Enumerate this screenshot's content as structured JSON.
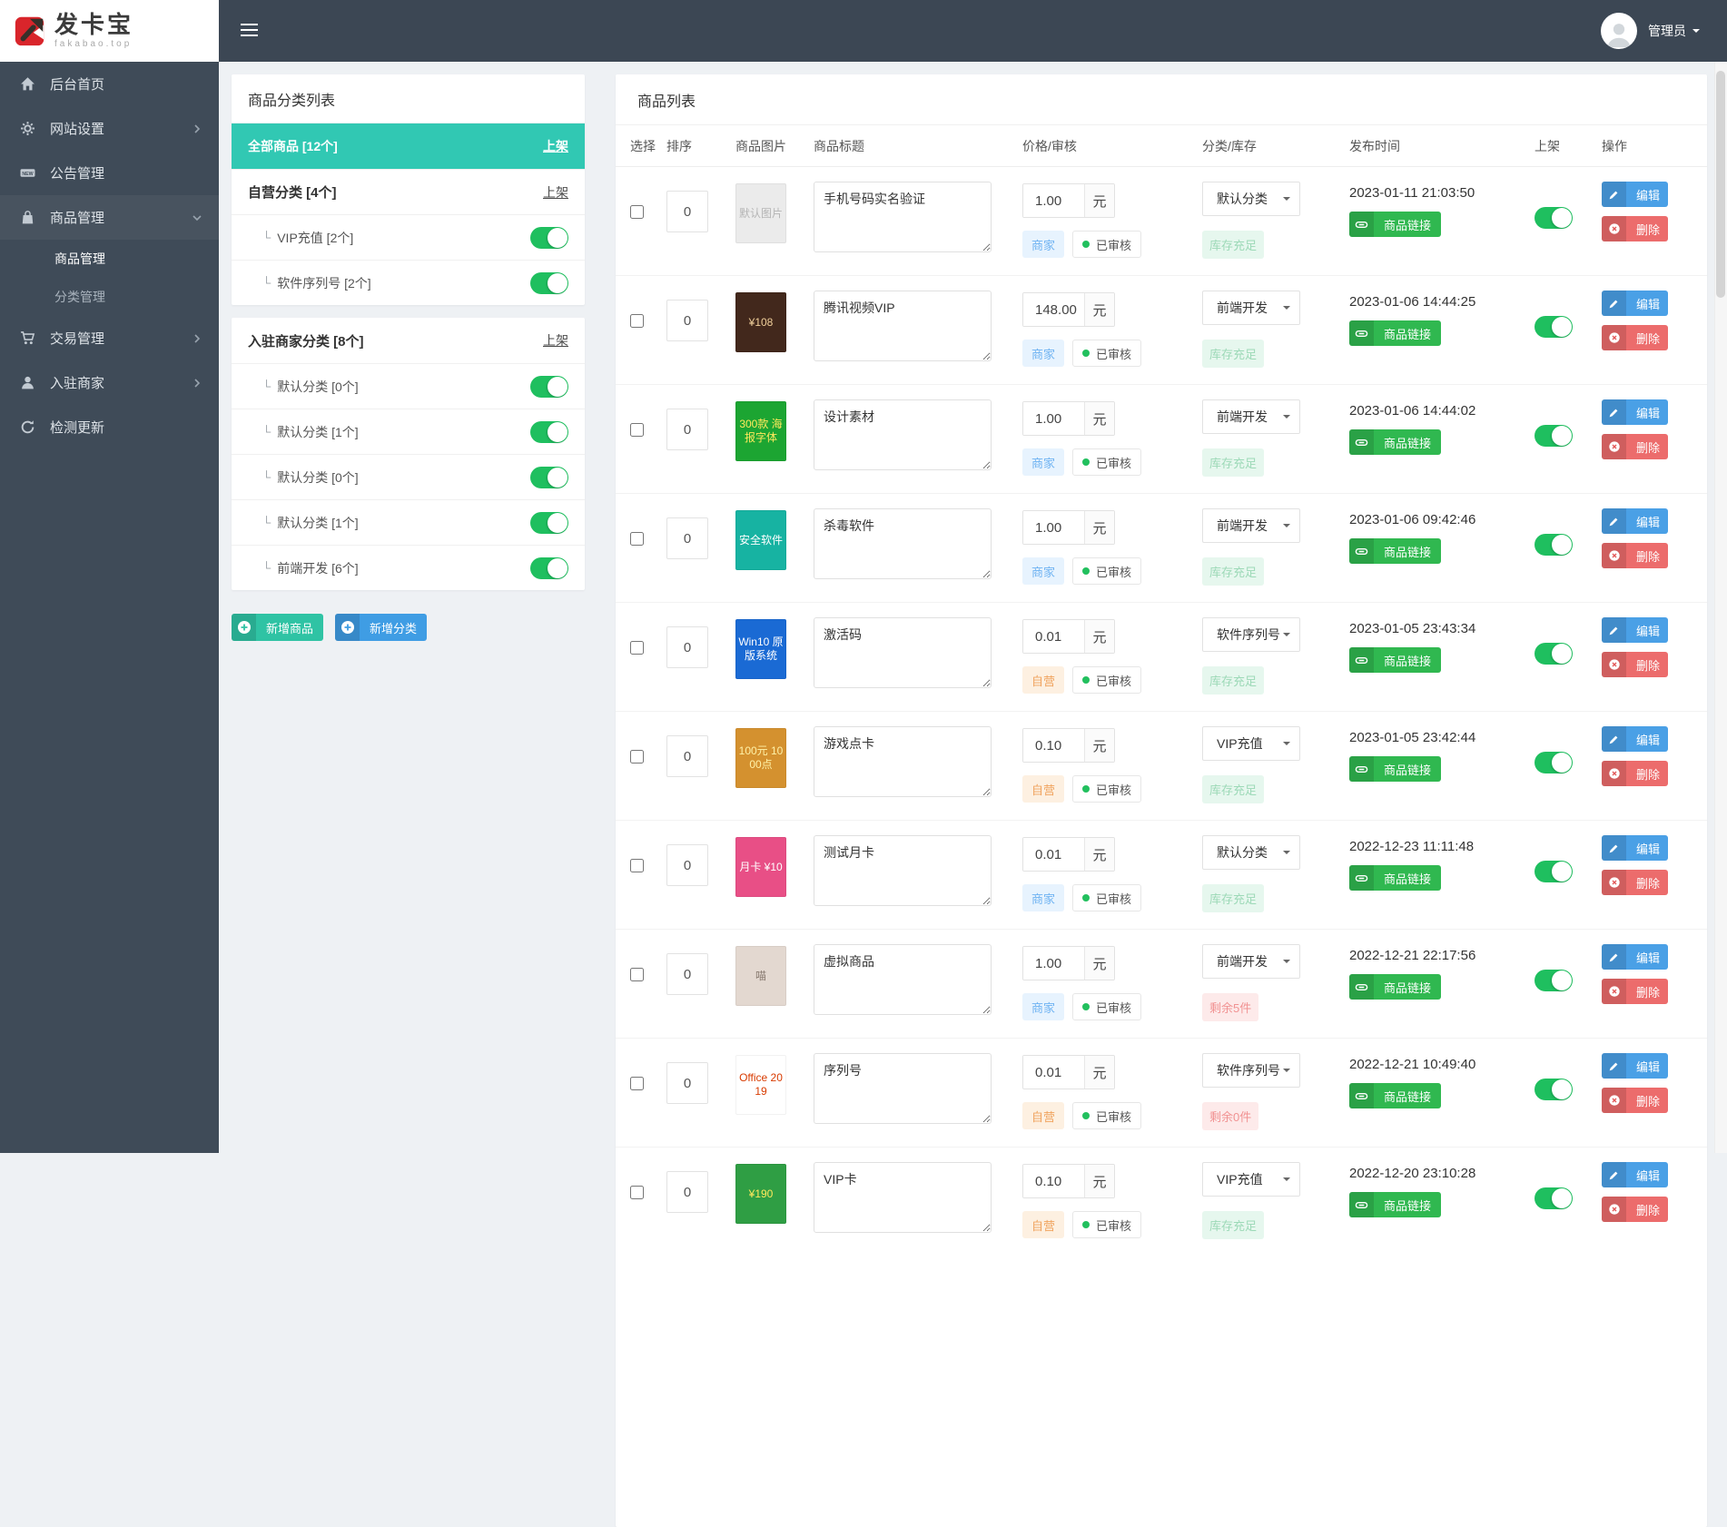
{
  "colors": {
    "accent_teal": "#31c8b3",
    "toggle_green": "#1fbf5f",
    "edit_blue": "#4aa0e6",
    "delete_red": "#ec6c6c",
    "link_green": "#30b850",
    "add_product_teal": "#2fc3a4",
    "add_category_blue": "#3f9de4",
    "sidebar_dark": "#3f4b58"
  },
  "topbar": {
    "logo_title": "发卡宝",
    "logo_subtitle": "fakabao.top",
    "user_label": "管理员"
  },
  "sidebar": {
    "items": [
      {
        "label": "后台首页"
      },
      {
        "label": "网站设置"
      },
      {
        "label": "公告管理"
      },
      {
        "label": "商品管理"
      },
      {
        "label": "交易管理"
      },
      {
        "label": "入驻商家"
      },
      {
        "label": "检测更新"
      }
    ],
    "submenu": [
      {
        "label": "商品管理"
      },
      {
        "label": "分类管理"
      }
    ]
  },
  "category_panel": {
    "title": "商品分类列表",
    "sub_prefix": "└",
    "selected": {
      "label": "全部商品 [12个]",
      "action": "上架"
    },
    "group1": {
      "header": "自营分类 [4个]",
      "action": "上架",
      "subs": [
        {
          "label": "VIP充值 [2个]"
        },
        {
          "label": "软件序列号 [2个]"
        }
      ]
    },
    "group2": {
      "header": "入驻商家分类 [8个]",
      "action": "上架",
      "subs": [
        {
          "label": "默认分类 [0个]"
        },
        {
          "label": "默认分类 [1个]"
        },
        {
          "label": "默认分类 [0个]"
        },
        {
          "label": "默认分类 [1个]"
        },
        {
          "label": "前端开发 [6个]"
        }
      ]
    },
    "add_product_label": "新增商品",
    "add_category_label": "新增分类"
  },
  "product_panel": {
    "title": "商品列表",
    "columns": [
      "选择",
      "排序",
      "商品图片",
      "商品标题",
      "价格/审核",
      "分类/库存",
      "发布时间",
      "上架",
      "操作"
    ],
    "price_unit": "元",
    "audit_label": "已审核",
    "link_label": "商品链接",
    "edit_label": "编辑",
    "delete_label": "删除",
    "rows": [
      {
        "sort": "0",
        "image": {
          "text": "默认图片",
          "bg": "#ebebeb",
          "fg": "#b5b5b5"
        },
        "title": "手机号码实名验证",
        "price": "1.00",
        "seller": "商家",
        "seller_type": "blue",
        "category": "默认分类",
        "stock": "库存充足",
        "stock_type": "ok",
        "date": "2023-01-11 21:03:50"
      },
      {
        "sort": "0",
        "image": {
          "text": "¥108",
          "bg": "#42281c",
          "fg": "#f0cf9a"
        },
        "title": "腾讯视频VIP",
        "price": "148.00",
        "seller": "商家",
        "seller_type": "blue",
        "category": "前端开发",
        "stock": "库存充足",
        "stock_type": "ok",
        "date": "2023-01-06 14:44:25"
      },
      {
        "sort": "0",
        "image": {
          "text": "300款 海报字体",
          "bg": "#1ca532",
          "fg": "#ffe95c"
        },
        "title": "设计素材",
        "price": "1.00",
        "seller": "商家",
        "seller_type": "blue",
        "category": "前端开发",
        "stock": "库存充足",
        "stock_type": "ok",
        "date": "2023-01-06 14:44:02"
      },
      {
        "sort": "0",
        "image": {
          "text": "安全软件",
          "bg": "#17b3a2",
          "fg": "#ffffff"
        },
        "title": "杀毒软件",
        "price": "1.00",
        "seller": "商家",
        "seller_type": "blue",
        "category": "前端开发",
        "stock": "库存充足",
        "stock_type": "ok",
        "date": "2023-01-06 09:42:46"
      },
      {
        "sort": "0",
        "image": {
          "text": "Win10 原版系统",
          "bg": "#1a6ad4",
          "fg": "#ffffff"
        },
        "title": "激活码",
        "price": "0.01",
        "seller": "自营",
        "seller_type": "orange",
        "category": "软件序列号",
        "stock": "库存充足",
        "stock_type": "ok",
        "date": "2023-01-05 23:43:34"
      },
      {
        "sort": "0",
        "image": {
          "text": "100元 1000点",
          "bg": "#d4912f",
          "fg": "#fff2a8"
        },
        "title": "游戏点卡",
        "price": "0.10",
        "seller": "自营",
        "seller_type": "orange",
        "category": "VIP充值",
        "stock": "库存充足",
        "stock_type": "ok",
        "date": "2023-01-05 23:42:44"
      },
      {
        "sort": "0",
        "image": {
          "text": "月卡 ¥10",
          "bg": "#e84f86",
          "fg": "#ffffff"
        },
        "title": "测试月卡",
        "price": "0.01",
        "seller": "商家",
        "seller_type": "blue",
        "category": "默认分类",
        "stock": "库存充足",
        "stock_type": "ok",
        "date": "2022-12-23 11:11:48"
      },
      {
        "sort": "0",
        "image": {
          "text": "喵",
          "bg": "#e3d8d0",
          "fg": "#8a7c72"
        },
        "title": "虚拟商品",
        "price": "1.00",
        "seller": "商家",
        "seller_type": "blue",
        "category": "前端开发",
        "stock": "剩余5件",
        "stock_type": "low",
        "date": "2022-12-21 22:17:56"
      },
      {
        "sort": "0",
        "image": {
          "text": "Office 2019",
          "bg": "#ffffff",
          "fg": "#d83b01"
        },
        "title": "序列号",
        "price": "0.01",
        "seller": "自营",
        "seller_type": "orange",
        "category": "软件序列号",
        "stock": "剩余0件",
        "stock_type": "low",
        "date": "2022-12-21 10:49:40"
      },
      {
        "sort": "0",
        "image": {
          "text": "¥190",
          "bg": "#2f9e44",
          "fg": "#ffe95c"
        },
        "title": "VIP卡",
        "price": "0.10",
        "seller": "自营",
        "seller_type": "orange",
        "category": "VIP充值",
        "stock": "库存充足",
        "stock_type": "ok",
        "date": "2022-12-20 23:10:28"
      }
    ]
  }
}
